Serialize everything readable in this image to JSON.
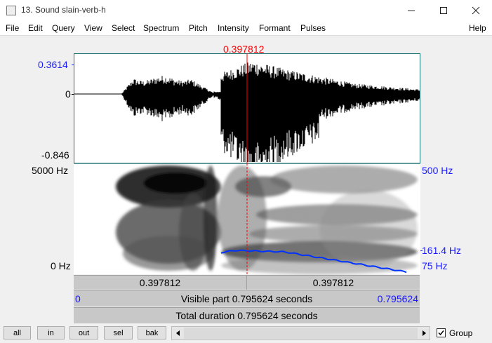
{
  "window": {
    "title": "13. Sound slain-verb-h",
    "minimize_icon": "minimize-icon",
    "maximize_icon": "maximize-icon",
    "close_icon": "close-icon"
  },
  "menu": [
    "File",
    "Edit",
    "Query",
    "View",
    "Select",
    "Spectrum",
    "Pitch",
    "Intensity",
    "Formant",
    "Pulses",
    "Help"
  ],
  "waveform": {
    "cursor_time": "0.397812",
    "max_label": "0.3614",
    "zero_label": "0",
    "min_label": "-0.846",
    "cursor_fraction": 0.5
  },
  "spectrogram": {
    "top_freq": "5000 Hz",
    "bottom_freq": "0 Hz",
    "pitch_top": "500 Hz",
    "pitch_current": "161.4 Hz",
    "pitch_bottom": "75 Hz"
  },
  "time_bars": {
    "left_segment": "0.397812",
    "right_segment": "0.397812",
    "visible_start": "0",
    "visible_label": "Visible part 0.795624 seconds",
    "visible_end": "0.795624",
    "total_label": "Total duration 0.795624 seconds"
  },
  "buttons": {
    "all": "all",
    "in": "in",
    "out": "out",
    "sel": "sel",
    "bak": "bak"
  },
  "scroll": {
    "left_icon": "scroll-left-icon",
    "right_icon": "scroll-right-icon"
  },
  "group": {
    "label": "Group",
    "checked": true
  },
  "colors": {
    "cursor": "#ff0000",
    "axis_labels": "#1a1aff",
    "pitch_curve": "#0033ff",
    "frame": "#1a6e6e"
  }
}
